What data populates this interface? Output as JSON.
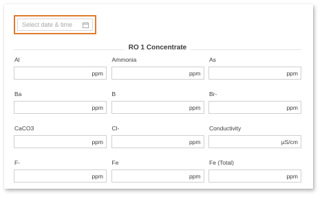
{
  "date_picker": {
    "placeholder": "Select date & time",
    "icon": "calendar-icon"
  },
  "section": {
    "title": "RO 1 Concentrate"
  },
  "fields": [
    {
      "label": "Al",
      "unit": "ppm"
    },
    {
      "label": "Ammonia",
      "unit": "ppm"
    },
    {
      "label": "As",
      "unit": "ppm"
    },
    {
      "label": "Ba",
      "unit": "ppm"
    },
    {
      "label": "B",
      "unit": "ppm"
    },
    {
      "label": "Br-",
      "unit": "ppm"
    },
    {
      "label": "CaCO3",
      "unit": "ppm"
    },
    {
      "label": "Cl-",
      "unit": "ppm"
    },
    {
      "label": "Conductivity",
      "unit": "µS/cm"
    },
    {
      "label": "F-",
      "unit": "ppm"
    },
    {
      "label": "Fe",
      "unit": "ppm"
    },
    {
      "label": "Fe (Total)",
      "unit": "ppm"
    }
  ],
  "colors": {
    "focus_border": "#e07a2c",
    "input_border": "#cfcfcf",
    "placeholder": "#a7a7a7"
  }
}
